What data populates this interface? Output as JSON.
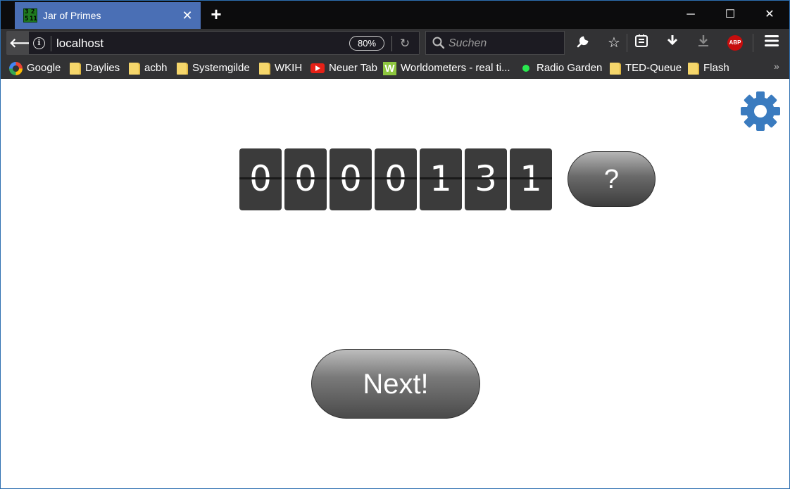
{
  "browser": {
    "tab": {
      "title": "Jar of Primes",
      "favicon_text": [
        "3",
        "2",
        "5",
        "11"
      ]
    },
    "window_controls": {
      "minimize": "─",
      "maximize": "☐",
      "close": "✕"
    },
    "navbar": {
      "url": "localhost",
      "zoom": "80%",
      "search_placeholder": "Suchen"
    },
    "bookmarks": [
      {
        "label": "Google",
        "icon": "google-icon"
      },
      {
        "label": "Daylies",
        "icon": "folder-icon"
      },
      {
        "label": "acbh",
        "icon": "folder-icon"
      },
      {
        "label": "Systemgilde",
        "icon": "folder-icon"
      },
      {
        "label": "WKIH",
        "icon": "folder-icon"
      },
      {
        "label": "Neuer Tab",
        "icon": "youtube-icon"
      },
      {
        "label": "Worldometers - real ti...",
        "icon": "worldometers-icon"
      },
      {
        "label": "Radio Garden",
        "icon": "radio-garden-icon"
      },
      {
        "label": "TED-Queue",
        "icon": "folder-icon"
      },
      {
        "label": "Flash",
        "icon": "folder-icon"
      }
    ],
    "toolbar_icons": [
      "wrench-icon",
      "bookmark-star-icon",
      "reader-list-icon",
      "download-icon",
      "download-grey-icon",
      "adblock-plus-icon",
      "hamburger-menu-icon"
    ],
    "abp_label": "ABP",
    "overflow": "»"
  },
  "page": {
    "counter_digits": [
      "0",
      "0",
      "0",
      "0",
      "1",
      "3",
      "1"
    ],
    "help_label": "?",
    "next_label": "Next!",
    "gear_color": "#3a7bbf"
  }
}
